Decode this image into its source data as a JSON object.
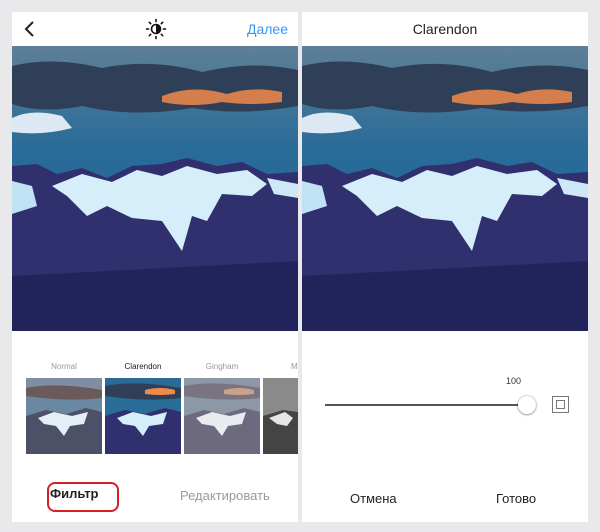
{
  "left_panel": {
    "next_label": "Далее",
    "filters": [
      {
        "name": "Normal"
      },
      {
        "name": "Clarendon"
      },
      {
        "name": "Gingham"
      },
      {
        "name": "M"
      }
    ],
    "tabs": {
      "filter_label": "Фильтр",
      "edit_label": "Редактировать"
    }
  },
  "right_panel": {
    "title": "Clarendon",
    "slider_value": "100",
    "cancel_label": "Отмена",
    "done_label": "Готово"
  },
  "colors": {
    "accent": "#3897f0",
    "highlight": "#d41f26"
  },
  "icons": {
    "back": "chevron-left-icon",
    "brightness": "sun-icon",
    "frame": "square-frame-icon"
  }
}
